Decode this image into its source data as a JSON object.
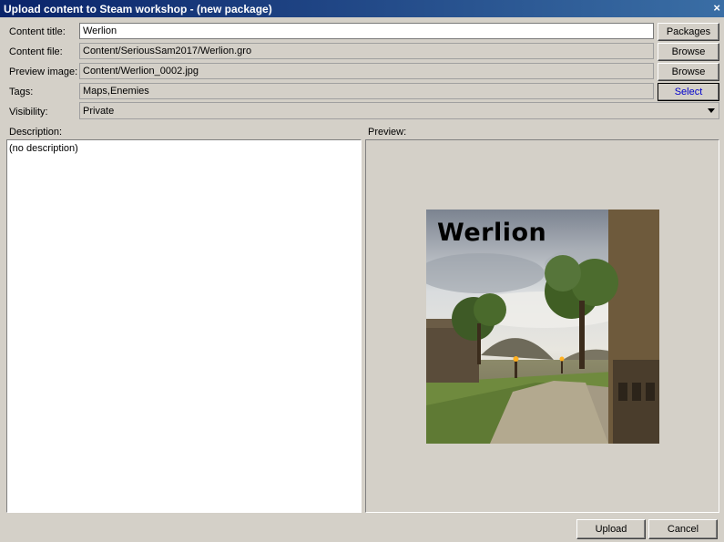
{
  "window": {
    "title": "Upload content to Steam workshop - (new package)",
    "close_glyph": "×"
  },
  "form": {
    "content_title": {
      "label": "Content title:",
      "value": "Werlion",
      "button": "Packages"
    },
    "content_file": {
      "label": "Content file:",
      "value": "Content/SeriousSam2017/Werlion.gro",
      "button": "Browse"
    },
    "preview_image": {
      "label": "Preview image:",
      "value": "Content/Werlion_0002.jpg",
      "button": "Browse"
    },
    "tags": {
      "label": "Tags:",
      "value": "Maps,Enemies",
      "button": "Select"
    },
    "visibility": {
      "label": "Visibility:",
      "value": "Private"
    }
  },
  "description": {
    "label": "Description:",
    "text": "(no description)"
  },
  "preview": {
    "label": "Preview:",
    "image_caption": "Werlion"
  },
  "footer": {
    "upload": "Upload",
    "cancel": "Cancel"
  },
  "colors": {
    "titlebar_start": "#0a246a",
    "titlebar_end": "#3a6ea5",
    "dialog_bg": "#d4d0c8",
    "select_text": "#0000cc"
  }
}
